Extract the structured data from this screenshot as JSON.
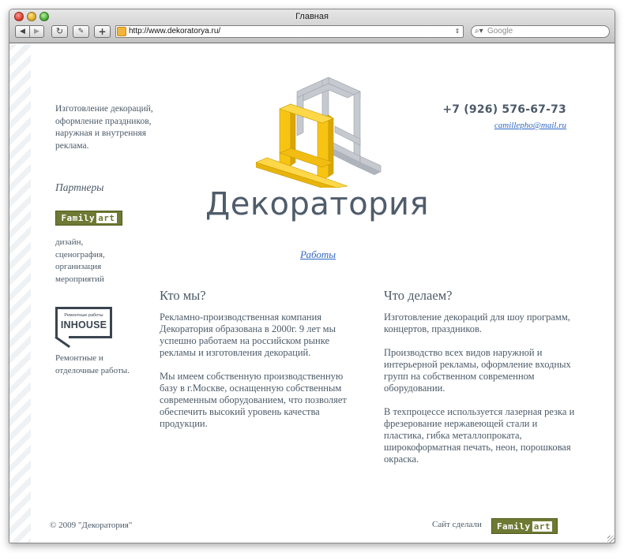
{
  "window": {
    "title": "Главная"
  },
  "toolbar": {
    "back_glyph": "◀",
    "forward_glyph": "▶",
    "reload_glyph": "↻",
    "snapshot_glyph": "✎",
    "add_glyph": "+"
  },
  "address_bar": {
    "url": "http://www.dekoratorya.ru/",
    "go_glyph": "⇕"
  },
  "search": {
    "icon_glyph": "⌕▾",
    "placeholder": "Google"
  },
  "sidebar": {
    "tagline": "Изготовление декораций, оформление праздников, наружная и внутренняя реклама.",
    "partners_title": "Партнеры",
    "partner1": {
      "logo_left": "Family",
      "logo_right": "art",
      "description": "дизайн, сценография, организация мероприятий"
    },
    "partner2": {
      "logo_small": "Ремонтные работы",
      "logo_big": "INHOUSE",
      "description": "Ремонтные и отделочные работы."
    }
  },
  "contacts": {
    "phone": "+7 (926) 576-67-73",
    "email": "camillepho@mail.ru"
  },
  "brand": {
    "name": "Декоратория",
    "works_link": "Работы"
  },
  "columns": {
    "about": {
      "title": "Кто мы?",
      "p1": "Рекламно-производственная компания Декоратория образована в 2000г. 9 лет мы успешно работаем на российском рынке рекламы и изготовления декораций.",
      "p2": "Мы имеем собственную производственную базу в г.Москве, оснащенную собственным современным оборудованием, что позволяет обеспечить высокий уровень качества продукции."
    },
    "services": {
      "title": "Что делаем?",
      "p1": "Изготовление декораций для шоу программ, концертов, праздников.",
      "p2": "Производство всех видов наружной и интерьерной рекламы, оформление входных групп на собственном современном оборудовании.",
      "p3": "В техпроцессе используется лазерная резка и фрезерование нержавеющей стали и пластика, гибка металлопроката, широкоформатная печать, неон, порошковая окраска."
    }
  },
  "footer": {
    "copyright": "© 2009 \"Декоратория\"",
    "made_by": "Сайт сделали",
    "logo_left": "Family",
    "logo_right": "art"
  },
  "colors": {
    "text": "#4c5a68",
    "link": "#2f66c4",
    "logo_olive": "#6e7a33",
    "cube_yellow": "#f4c20d",
    "cube_grey": "#b7bcc4"
  }
}
